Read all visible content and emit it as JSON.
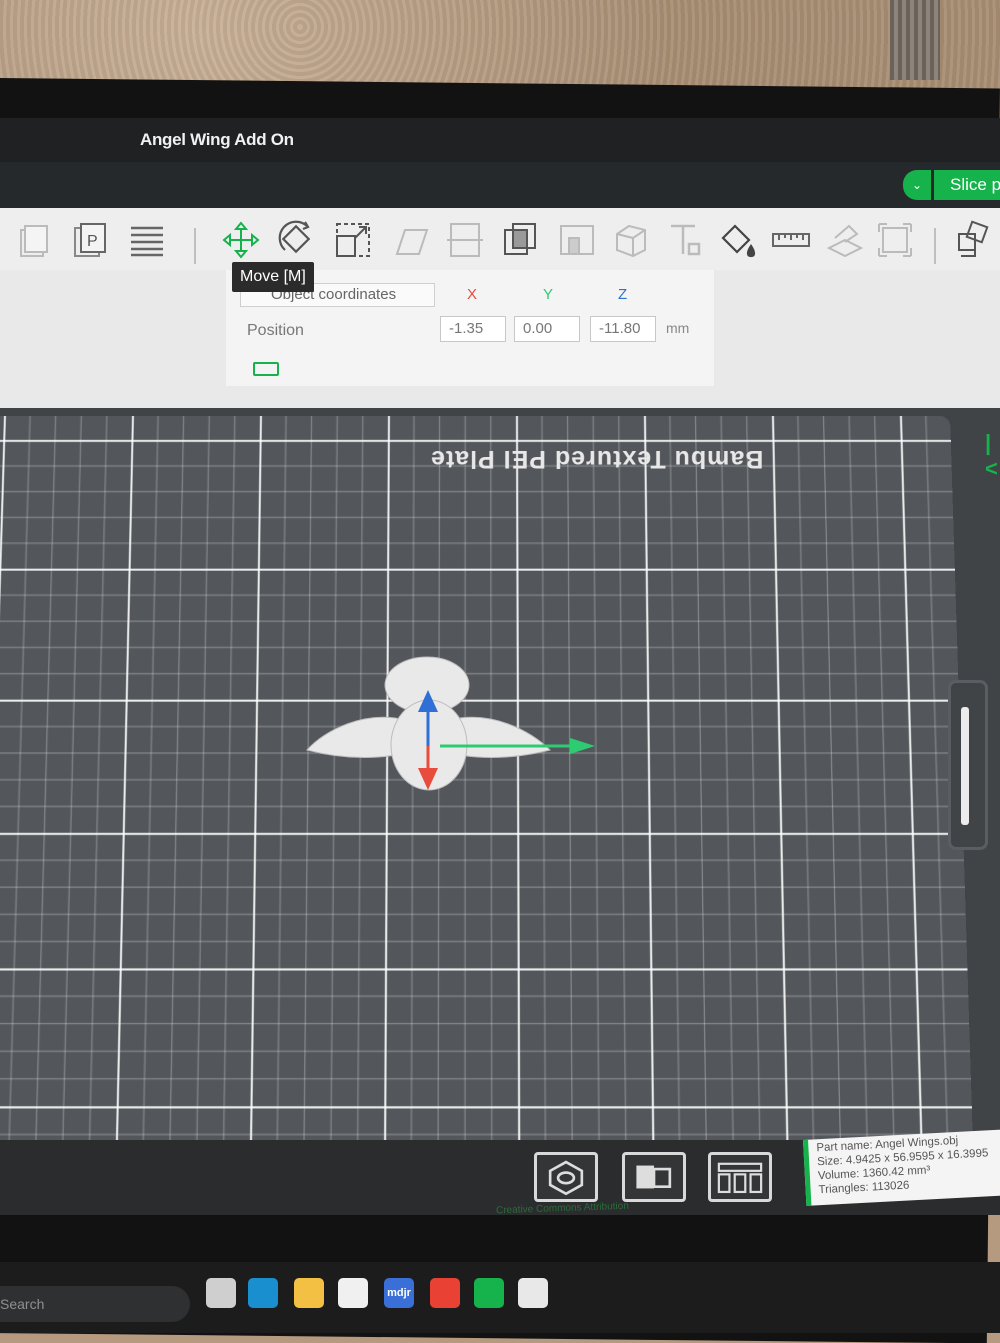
{
  "window": {
    "title": "Angel Wing Add On"
  },
  "slice": {
    "label": "Slice p",
    "dropdown_glyph": "⌄"
  },
  "toolbar": {
    "tools": [
      {
        "name": "add-icon"
      },
      {
        "name": "add-plate-icon"
      },
      {
        "name": "arrange-icon"
      },
      {
        "name": "move-icon"
      },
      {
        "name": "rotate-icon"
      },
      {
        "name": "scale-icon"
      },
      {
        "name": "lay-on-face-icon"
      },
      {
        "name": "cut-icon"
      },
      {
        "name": "boolean-icon"
      },
      {
        "name": "support-paint-icon"
      },
      {
        "name": "seam-paint-icon"
      },
      {
        "name": "text-icon"
      },
      {
        "name": "color-paint-icon"
      },
      {
        "name": "measure-icon"
      },
      {
        "name": "assembly-icon"
      },
      {
        "name": "fit-icon"
      },
      {
        "name": "split-icon"
      }
    ],
    "tooltip": "Move [M]"
  },
  "move_panel": {
    "coord_system": "Object coordinates",
    "axes": {
      "x": "X",
      "y": "Y",
      "z": "Z"
    },
    "axis_colors": {
      "x": "#e74c3c",
      "y": "#2ecc71",
      "z": "#2f6fd6"
    },
    "position_label": "Position",
    "x_value": "-1.35",
    "y_value": "0.00",
    "z_value": "-11.80",
    "unit": "mm"
  },
  "viewport": {
    "plate_label": "Bambu Textured PEI Plate",
    "side_mark": "|<"
  },
  "view_buttons": [
    {
      "name": "iso-view-button"
    },
    {
      "name": "single-plate-button"
    },
    {
      "name": "multi-plate-button"
    }
  ],
  "part_info": {
    "name_line": "Part name: Angel Wings.obj",
    "size_line": "Size: 4.9425 x 56.9595 x 16.3995",
    "volume_line": "Volume: 1360.42 mm³",
    "triangles_line": "Triangles: 113026"
  },
  "attribution": "Creative Commons Attribution",
  "taskbar": {
    "search_placeholder": "Search",
    "apps": [
      {
        "name": "file-icon",
        "color": "#cfcfcf",
        "glyph": ""
      },
      {
        "name": "edge-icon",
        "color": "#1a8fd0",
        "glyph": ""
      },
      {
        "name": "explorer-icon",
        "color": "#f4c043",
        "glyph": ""
      },
      {
        "name": "store-icon",
        "color": "#f0f0f0",
        "glyph": ""
      },
      {
        "name": "meet-icon",
        "color": "#3a6fd8",
        "glyph": "mdjr"
      },
      {
        "name": "chrome-icon",
        "color": "#e94235",
        "glyph": ""
      },
      {
        "name": "bambu-studio-icon",
        "color": "#16b24b",
        "glyph": ""
      },
      {
        "name": "snip-icon",
        "color": "#e8e8e8",
        "glyph": ""
      }
    ]
  }
}
